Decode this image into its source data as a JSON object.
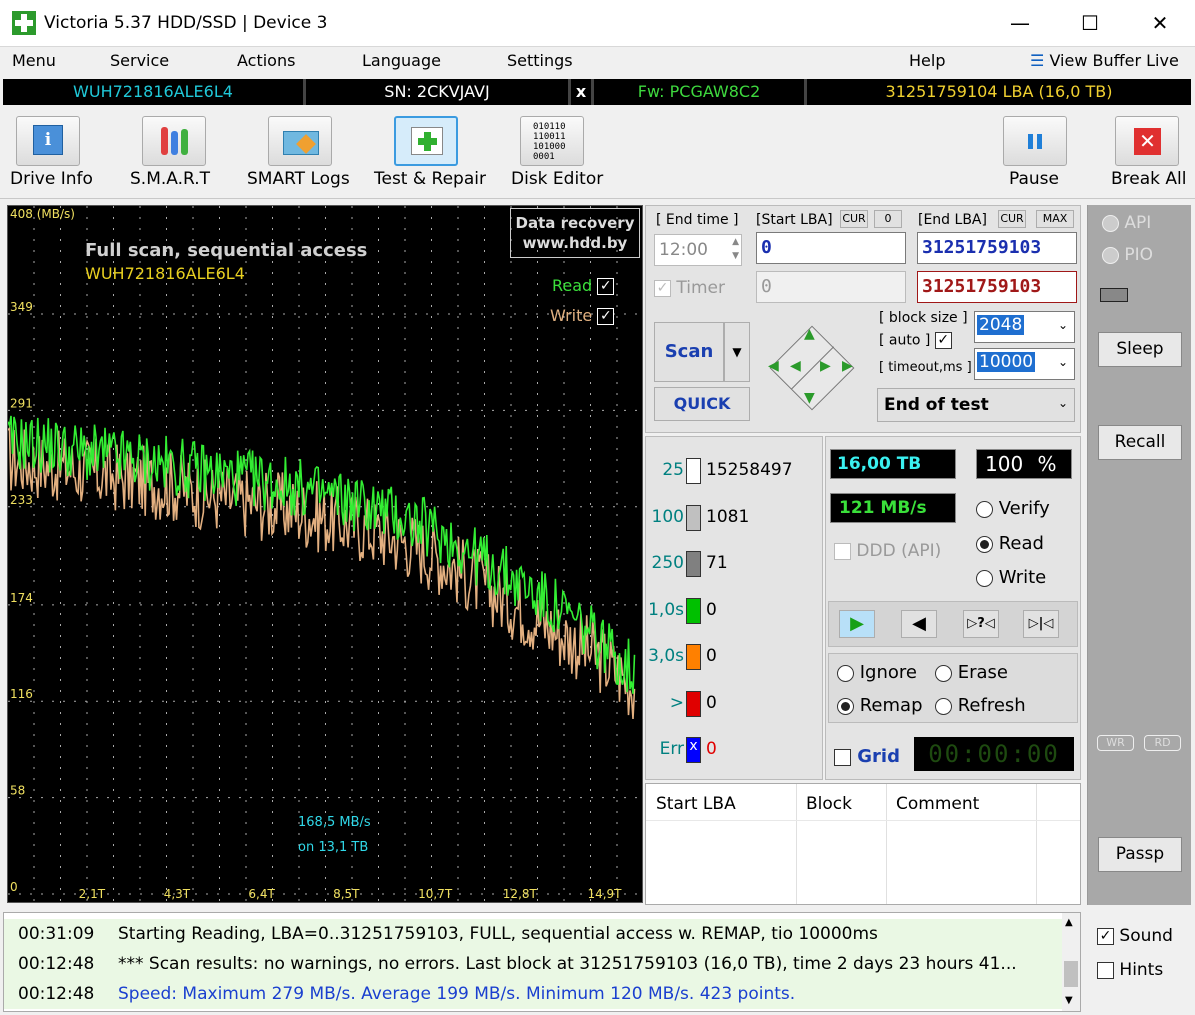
{
  "app": {
    "title": "Victoria 5.37 HDD/SSD | Device 3"
  },
  "menu": {
    "items": [
      "Menu",
      "Service",
      "Actions",
      "Language",
      "Settings",
      "Help"
    ],
    "view_buffer": "View Buffer Live"
  },
  "info": {
    "model": "WUH721816ALE6L4",
    "serial": "SN: 2CKVJAVJ",
    "close_x": "x",
    "firmware": "Fw: PCGAW8C2",
    "capacity": "31251759104 LBA (16,0 TB)"
  },
  "toolbar": {
    "drive_info": "Drive Info",
    "smart": "S.M.A.R.T",
    "smart_logs": "SMART Logs",
    "test_repair": "Test & Repair",
    "disk_editor": "Disk Editor",
    "pause": "Pause",
    "break_all": "Break All"
  },
  "graph": {
    "unit": "408 (MB/s)",
    "title": "Full scan, sequential access",
    "model": "WUH721816ALE6L4",
    "recovery_line1": "Data recovery",
    "recovery_line2": "www.hdd.by",
    "read_label": "Read",
    "write_label": "Write",
    "y_ticks": [
      "349",
      "291",
      "233",
      "174",
      "116",
      "58",
      "0"
    ],
    "x_ticks": [
      "2,1T",
      "4,3T",
      "6,4T",
      "8,5T",
      "10,7T",
      "12,8T",
      "14,9T"
    ],
    "speed_readout": "168,5 MB/s",
    "position_readout": "on 13,1 TB"
  },
  "chart_data": {
    "type": "line",
    "title": "Full scan, sequential access",
    "ylabel": "MB/s",
    "ylim": [
      0,
      408
    ],
    "xlim": [
      0,
      16
    ],
    "x_unit": "TB",
    "series": [
      {
        "name": "Read",
        "color": "#33ee33",
        "x": [
          0,
          1,
          2,
          3,
          4,
          5,
          6,
          7,
          8,
          9,
          10,
          11,
          12,
          13,
          14,
          15,
          16
        ],
        "values": [
          272,
          270,
          265,
          262,
          258,
          254,
          250,
          246,
          240,
          234,
          226,
          215,
          200,
          185,
          168,
          150,
          128
        ]
      },
      {
        "name": "Write",
        "color": "#e3b080",
        "x": [
          0,
          1,
          2,
          3,
          4,
          5,
          6,
          7,
          8,
          9,
          10,
          11,
          12,
          13,
          14,
          15,
          16
        ],
        "values": [
          262,
          258,
          254,
          250,
          246,
          240,
          236,
          232,
          226,
          220,
          212,
          200,
          185,
          170,
          155,
          140,
          120
        ]
      }
    ]
  },
  "scan": {
    "end_time_label": "[ End time ]",
    "start_lba_label": "[Start LBA]",
    "cur_label": "CUR",
    "cur_value": "0",
    "end_lba_label": "[End LBA]",
    "max_label": "MAX",
    "time_value": "12:00",
    "start_lba": "0",
    "end_lba": "31251759103",
    "timer_label": "Timer",
    "timer_value": "0",
    "end_lba2": "31251759103",
    "scan_btn": "Scan",
    "quick_btn": "QUICK",
    "block_size_label": "[ block size ]",
    "auto_label": "[ auto ]",
    "block_size": "2048",
    "timeout_label": "[ timeout,ms ]",
    "timeout": "10000",
    "end_action": "End of test"
  },
  "stats": [
    {
      "label": "25",
      "value": "15258497",
      "color": "#ffffff"
    },
    {
      "label": "100",
      "value": "1081",
      "color": "#c0c0c0"
    },
    {
      "label": "250",
      "value": "71",
      "color": "#808080"
    },
    {
      "label": "1,0s",
      "value": "0",
      "color": "#00c000"
    },
    {
      "label": "3,0s",
      "value": "0",
      "color": "#ff8000"
    },
    {
      "label": ">",
      "value": "0",
      "color": "#e00000"
    },
    {
      "label": "Err",
      "value": "0",
      "color": "#0000ff"
    }
  ],
  "progress": {
    "size": "16,00 TB",
    "percent": "100",
    "percent_sign": "%",
    "speed": "121 MB/s",
    "ddd_label": "DDD (API)"
  },
  "mode": {
    "verify": "Verify",
    "read": "Read",
    "write": "Write"
  },
  "repair": {
    "ignore": "Ignore",
    "erase": "Erase",
    "remap": "Remap",
    "refresh": "Refresh"
  },
  "grid": {
    "label": "Grid",
    "clock": "00:00:00"
  },
  "blocks_table": {
    "headers": [
      "Start LBA",
      "Block",
      "Comment"
    ]
  },
  "side": {
    "api": "API",
    "pio": "PIO",
    "sleep": "Sleep",
    "recall": "Recall",
    "wr": "WR",
    "rd": "RD",
    "passp": "Passp",
    "sound": "Sound",
    "hints": "Hints"
  },
  "log": [
    {
      "time": "00:31:09",
      "msg": "Starting Reading, LBA=0..31251759103, FULL, sequential access w. REMAP, tio 10000ms",
      "color": "#000000"
    },
    {
      "time": "00:12:48",
      "msg": "*** Scan results: no warnings, no errors. Last block at 31251759103 (16,0 TB), time 2 days 23 hours 41...",
      "color": "#000000"
    },
    {
      "time": "00:12:48",
      "msg": "Speed: Maximum 279 MB/s. Average 199 MB/s. Minimum 120 MB/s. 423 points.",
      "color": "#1a3fcf"
    }
  ]
}
